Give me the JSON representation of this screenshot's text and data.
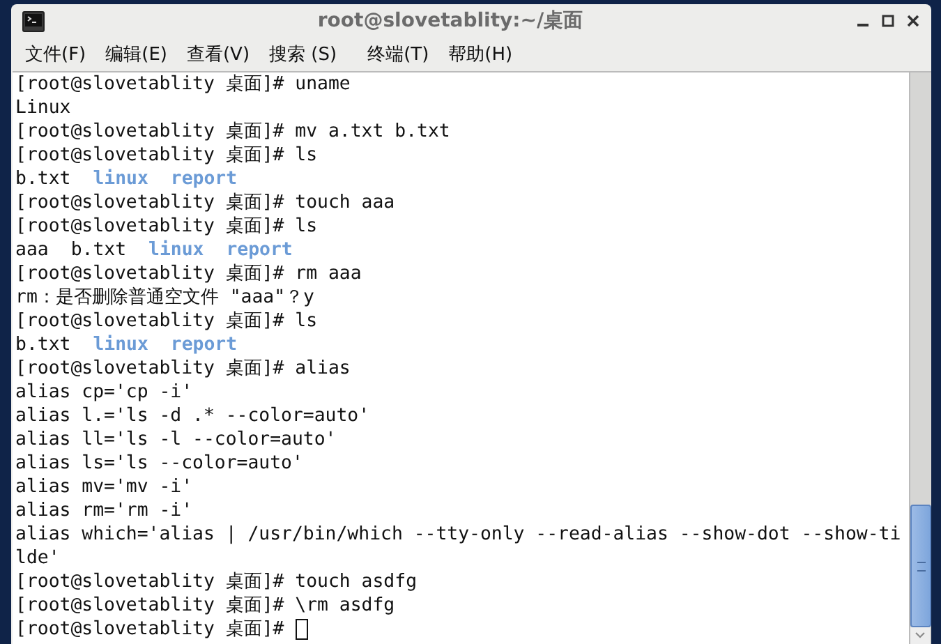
{
  "window": {
    "title": "root@slovetablity:~/桌面"
  },
  "menu": [
    {
      "label": "文件(F)"
    },
    {
      "label": "编辑(E)"
    },
    {
      "label": "查看(V)"
    },
    {
      "label": "搜索 (S)"
    },
    {
      "label": "终端(T)"
    },
    {
      "label": "帮助(H)"
    }
  ],
  "terminal": {
    "lines": [
      {
        "segments": [
          {
            "kind": "plain",
            "text": "[root@slovetablity 桌面]# uname"
          }
        ]
      },
      {
        "segments": [
          {
            "kind": "plain",
            "text": "Linux"
          }
        ]
      },
      {
        "segments": [
          {
            "kind": "plain",
            "text": "[root@slovetablity 桌面]# mv a.txt b.txt"
          }
        ]
      },
      {
        "segments": [
          {
            "kind": "plain",
            "text": "[root@slovetablity 桌面]# ls"
          }
        ]
      },
      {
        "segments": [
          {
            "kind": "plain",
            "text": "b.txt"
          },
          {
            "kind": "dir",
            "text": "linux"
          },
          {
            "kind": "dir",
            "text": "report"
          }
        ]
      },
      {
        "segments": [
          {
            "kind": "plain",
            "text": "[root@slovetablity 桌面]# touch aaa"
          }
        ]
      },
      {
        "segments": [
          {
            "kind": "plain",
            "text": "[root@slovetablity 桌面]# ls"
          }
        ]
      },
      {
        "segments": [
          {
            "kind": "plain",
            "text": "aaa"
          },
          {
            "kind": "plain",
            "text": "b.txt"
          },
          {
            "kind": "dir",
            "text": "linux"
          },
          {
            "kind": "dir",
            "text": "report"
          }
        ]
      },
      {
        "segments": [
          {
            "kind": "plain",
            "text": "[root@slovetablity 桌面]# rm aaa"
          }
        ]
      },
      {
        "segments": [
          {
            "kind": "plain",
            "text": "rm：是否删除普通空文件 \"aaa\"？y"
          }
        ]
      },
      {
        "segments": [
          {
            "kind": "plain",
            "text": "[root@slovetablity 桌面]# ls"
          }
        ]
      },
      {
        "segments": [
          {
            "kind": "plain",
            "text": "b.txt"
          },
          {
            "kind": "dir",
            "text": "linux"
          },
          {
            "kind": "dir",
            "text": "report"
          }
        ]
      },
      {
        "segments": [
          {
            "kind": "plain",
            "text": "[root@slovetablity 桌面]# alias"
          }
        ]
      },
      {
        "segments": [
          {
            "kind": "plain",
            "text": "alias cp='cp -i'"
          }
        ]
      },
      {
        "segments": [
          {
            "kind": "plain",
            "text": "alias l.='ls -d .* --color=auto'"
          }
        ]
      },
      {
        "segments": [
          {
            "kind": "plain",
            "text": "alias ll='ls -l --color=auto'"
          }
        ]
      },
      {
        "segments": [
          {
            "kind": "plain",
            "text": "alias ls='ls --color=auto'"
          }
        ]
      },
      {
        "segments": [
          {
            "kind": "plain",
            "text": "alias mv='mv -i'"
          }
        ]
      },
      {
        "segments": [
          {
            "kind": "plain",
            "text": "alias rm='rm -i'"
          }
        ]
      },
      {
        "segments": [
          {
            "kind": "plain",
            "text": "alias which='alias | /usr/bin/which --tty-only --read-alias --show-dot --show-ti"
          }
        ]
      },
      {
        "segments": [
          {
            "kind": "plain",
            "text": "lde'"
          }
        ]
      },
      {
        "segments": [
          {
            "kind": "plain",
            "text": "[root@slovetablity 桌面]# touch asdfg"
          }
        ]
      },
      {
        "segments": [
          {
            "kind": "plain",
            "text": "[root@slovetablity 桌面]# \\rm asdfg"
          }
        ]
      },
      {
        "segments": [
          {
            "kind": "plain",
            "text": "[root@slovetablity 桌面]#"
          }
        ],
        "cursor": true
      }
    ]
  }
}
